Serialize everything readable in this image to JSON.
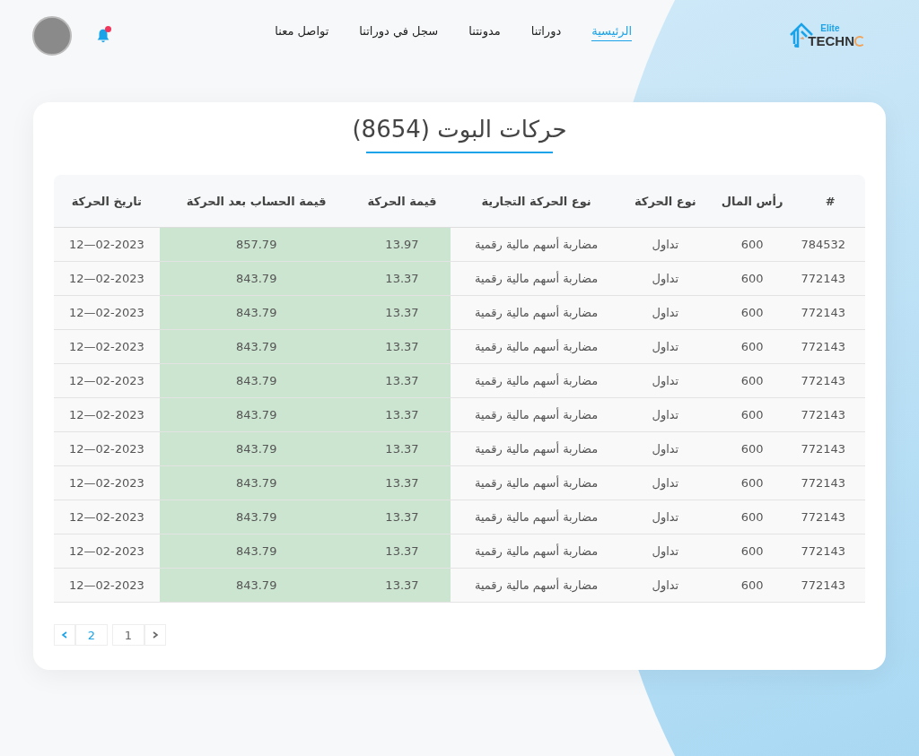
{
  "logo": {
    "top": "Elite",
    "bottom": "TECHN"
  },
  "nav": [
    {
      "label": "الرئيسية",
      "selected": true
    },
    {
      "label": "دوراتنا",
      "selected": false
    },
    {
      "label": "مدونتنا",
      "selected": false
    },
    {
      "label": "سجل في دوراتنا",
      "selected": false
    },
    {
      "label": "تواصل معنا",
      "selected": false
    }
  ],
  "notifications": {
    "unread": true
  },
  "title": "حركات البوت (8654)",
  "table": {
    "columns": [
      {
        "label": "#",
        "highlighted": false
      },
      {
        "label": "رأس المال",
        "highlighted": false
      },
      {
        "label": "نوع الحركة",
        "highlighted": false
      },
      {
        "label": "نوع الحركة التجارية",
        "highlighted": false
      },
      {
        "label": "قيمة الحركة",
        "highlighted": true
      },
      {
        "label": "قيمة الحساب بعد الحركة",
        "highlighted": true
      },
      {
        "label": "تاريخ الحركة",
        "highlighted": false
      }
    ],
    "rows": [
      [
        "784532",
        "600",
        "تداول",
        "مضاربة أسهم مالية رقمية",
        "13.97",
        "857.79",
        "12—02-2023"
      ],
      [
        "772143",
        "600",
        "تداول",
        "مضاربة أسهم مالية رقمية",
        "13.37",
        "843.79",
        "12—02-2023"
      ],
      [
        "772143",
        "600",
        "تداول",
        "مضاربة أسهم مالية رقمية",
        "13.37",
        "843.79",
        "12—02-2023"
      ],
      [
        "772143",
        "600",
        "تداول",
        "مضاربة أسهم مالية رقمية",
        "13.37",
        "843.79",
        "12—02-2023"
      ],
      [
        "772143",
        "600",
        "تداول",
        "مضاربة أسهم مالية رقمية",
        "13.37",
        "843.79",
        "12—02-2023"
      ],
      [
        "772143",
        "600",
        "تداول",
        "مضاربة أسهم مالية رقمية",
        "13.37",
        "843.79",
        "12—02-2023"
      ],
      [
        "772143",
        "600",
        "تداول",
        "مضاربة أسهم مالية رقمية",
        "13.37",
        "843.79",
        "12—02-2023"
      ],
      [
        "772143",
        "600",
        "تداول",
        "مضاربة أسهم مالية رقمية",
        "13.37",
        "843.79",
        "12—02-2023"
      ],
      [
        "772143",
        "600",
        "تداول",
        "مضاربة أسهم مالية رقمية",
        "13.37",
        "843.79",
        "12—02-2023"
      ],
      [
        "772143",
        "600",
        "تداول",
        "مضاربة أسهم مالية رقمية",
        "13.37",
        "843.79",
        "12—02-2023"
      ],
      [
        "772143",
        "600",
        "تداول",
        "مضاربة أسهم مالية رقمية",
        "13.37",
        "843.79",
        "12—02-2023"
      ]
    ]
  },
  "pagination": {
    "previous": {
      "disabled": true
    },
    "pages": [
      {
        "label": "1",
        "selected": true
      },
      {
        "label": "2",
        "selected": false
      }
    ],
    "next": {
      "disabled": false
    }
  }
}
